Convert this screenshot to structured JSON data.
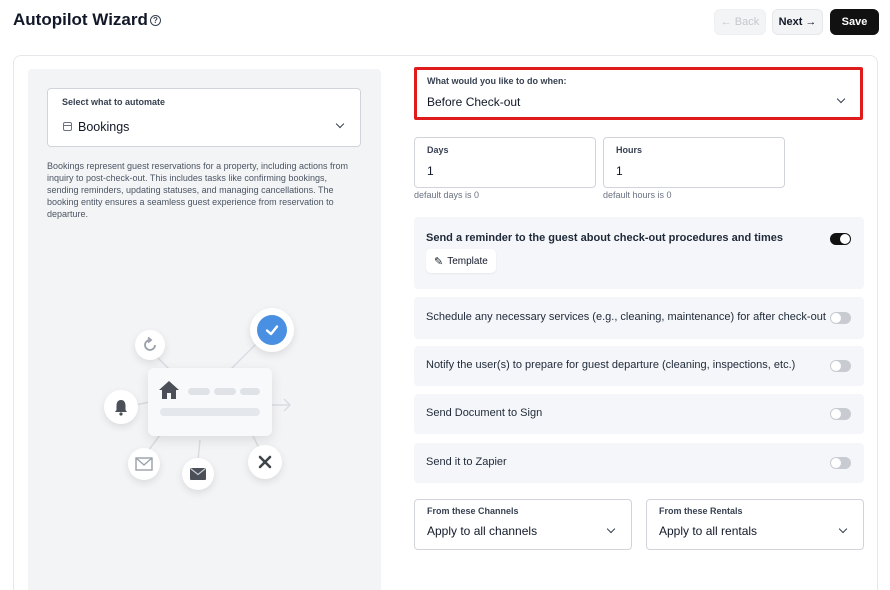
{
  "header": {
    "title": "Autopilot Wizard",
    "help_glyph": "?",
    "back_label": "Back",
    "next_label": "Next",
    "save_label": "Save"
  },
  "left": {
    "select_label": "Select what to automate",
    "select_value": "Bookings",
    "description": "Bookings represent guest reservations for a property, including actions from inquiry to post-check-out. This includes tasks like confirming bookings, sending reminders, updating statuses, and managing cancellations. The booking entity ensures a seamless guest experience from reservation to departure."
  },
  "trigger": {
    "label": "What would you like to do when:",
    "value": "Before Check-out"
  },
  "days": {
    "label": "Days",
    "value": "1",
    "hint": "default days is 0"
  },
  "hours": {
    "label": "Hours",
    "value": "1",
    "hint": "default hours is 0"
  },
  "actions": [
    {
      "label": "Send a reminder to the guest about check-out procedures and times",
      "enabled": true,
      "template_label": "Template"
    },
    {
      "label": "Schedule any necessary services (e.g., cleaning, maintenance) for after check-out",
      "enabled": false
    },
    {
      "label": "Notify the user(s) to prepare for guest departure (cleaning, inspections, etc.)",
      "enabled": false
    },
    {
      "label": "Send Document to Sign",
      "enabled": false
    },
    {
      "label": "Send it to Zapier",
      "enabled": false
    }
  ],
  "channels": {
    "label": "From these Channels",
    "value": "Apply to all channels"
  },
  "rentals": {
    "label": "From these Rentals",
    "value": "Apply to all rentals"
  },
  "colors": {
    "highlight": "#e01b1b",
    "accent": "#4a90e2",
    "primary_button": "#111111"
  },
  "icons": [
    "help-icon",
    "back-arrow-icon",
    "next-arrow-icon",
    "calendar-icon",
    "chevron-down-icon",
    "pencil-icon",
    "toggle-switch"
  ]
}
